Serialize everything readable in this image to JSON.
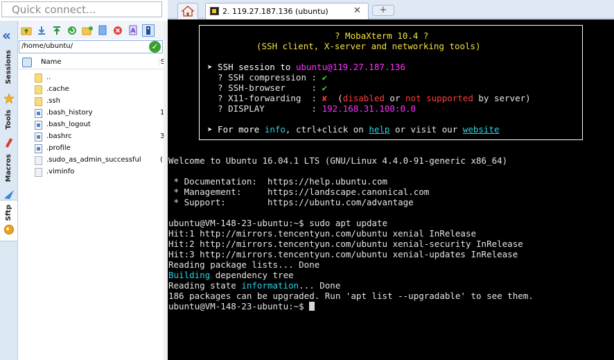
{
  "quick_connect": {
    "placeholder": "Quick connect..."
  },
  "side_tabs": [
    "Sessions",
    "Tools",
    "Macros",
    "Sftp"
  ],
  "sftp": {
    "path": "/home/ubuntu/",
    "columns": {
      "name": "Name",
      "size": "S"
    },
    "files": [
      {
        "name": "..",
        "type": "folder",
        "size": ""
      },
      {
        "name": ".cache",
        "type": "folder",
        "size": ""
      },
      {
        "name": ".ssh",
        "type": "folder",
        "size": ""
      },
      {
        "name": ".bash_history",
        "type": "file",
        "size": "1"
      },
      {
        "name": ".bash_logout",
        "type": "file",
        "size": ""
      },
      {
        "name": ".bashrc",
        "type": "file",
        "size": "3"
      },
      {
        "name": ".profile",
        "type": "file",
        "size": ""
      },
      {
        "name": ".sudo_as_admin_successful",
        "type": "file",
        "size": "("
      },
      {
        "name": ".viminfo",
        "type": "file",
        "size": ""
      }
    ]
  },
  "tabs": {
    "session_label": "2. 119.27.187.136 (ubuntu)",
    "close_glyph": "✕",
    "new_glyph": "+"
  },
  "terminal": {
    "banner_title": "? MobaXterm 10.4 ?",
    "banner_subtitle": "(SSH client, X-server and networking tools)",
    "session_prefix": "➤ SSH session to ",
    "session_user": "ubuntu",
    "session_host": "@119.27.187.136",
    "compression_label": "  ? SSH compression : ",
    "browser_label": "  ? SSH-browser     : ",
    "x11_label": "  ? X11-forwarding  : ",
    "x11_disabled": "disabled",
    "x11_or": " or ",
    "x11_unsupported": "not supported",
    "x11_by": " by server)",
    "display_label": "  ? DISPLAY         : ",
    "display_value": "192.168.31.100:0.0",
    "more_prefix": "➤ For more ",
    "more_info": "info",
    "more_mid": ", ctrl+click on ",
    "more_help": "help",
    "more_tail": " or visit our ",
    "more_site": "website",
    "check": "✔",
    "cross": "✘",
    "welcome": "Welcome to Ubuntu 16.04.1 LTS (GNU/Linux 4.4.0-91-generic x86_64)",
    "doc": " * Documentation:  https://help.ubuntu.com",
    "mgmt": " * Management:     https://landscape.canonical.com",
    "support": " * Support:        https://ubuntu.com/advantage",
    "prompt1": "ubuntu@VM-148-23-ubuntu:~$ sudo apt update",
    "hit1": "Hit:1 http://mirrors.tencentyun.com/ubuntu xenial InRelease",
    "hit2": "Hit:2 http://mirrors.tencentyun.com/ubuntu xenial-security InRelease",
    "hit3": "Hit:3 http://mirrors.tencentyun.com/ubuntu xenial-updates InRelease",
    "reading": "Reading package lists... Done",
    "building_word": "Building",
    "building_rest": " dependency tree",
    "state_prefix": "Reading state ",
    "state_word": "information",
    "state_rest": "... Done",
    "upgrade": "186 packages can be upgraded. Run 'apt list --upgradable' to see them.",
    "prompt2": "ubuntu@VM-148-23-ubuntu:~$ "
  }
}
